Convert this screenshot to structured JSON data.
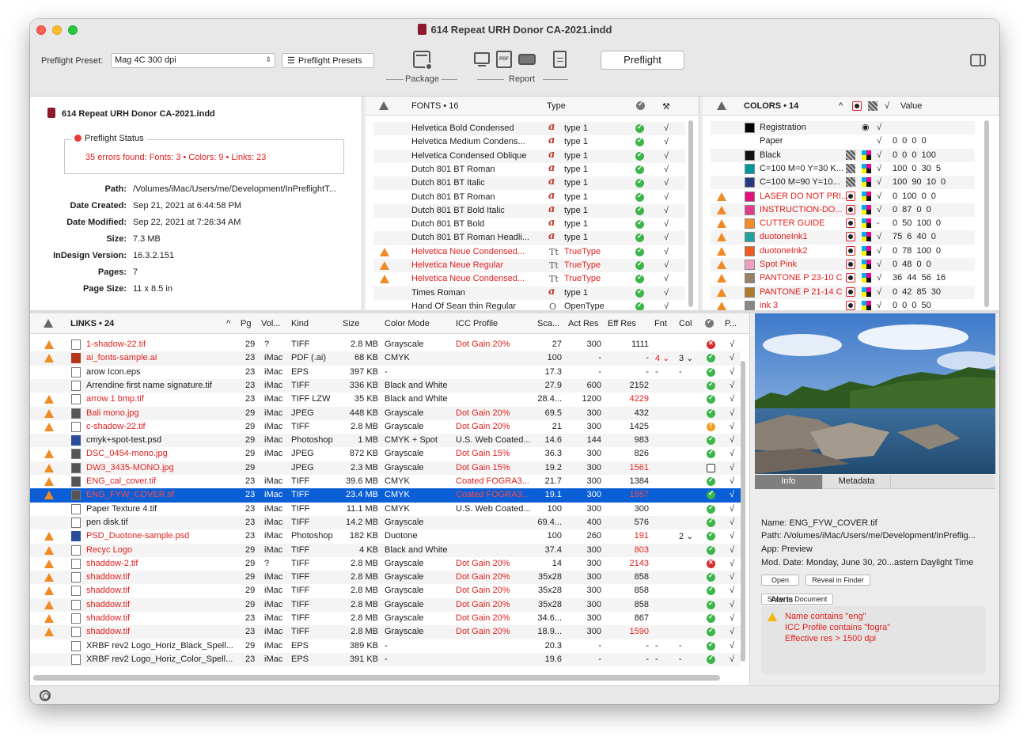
{
  "window": {
    "title": "614 Repeat URH Donor CA-2021.indd"
  },
  "toolbar": {
    "preset_label": "Preflight Preset:",
    "preset_value": "Mag 4C 300 dpi",
    "presets_button": "Preflight Presets",
    "package_label": "Package",
    "report_label": "Report",
    "preflight_button": "Preflight"
  },
  "info": {
    "doc_name": "614 Repeat URH Donor CA-2021.indd",
    "status_label": "Preflight Status",
    "status_errors": "35 errors found: Fonts: 3 • Colors: 9 • Links: 23",
    "rows": [
      {
        "k": "Path:",
        "v": "/Volumes/iMac/Users/me/Development/InPreflightT..."
      },
      {
        "k": "Date Created:",
        "v": "Sep 21, 2021 at 6:44:58 PM"
      },
      {
        "k": "Date Modified:",
        "v": "Sep 22, 2021 at 7:26:34 AM"
      },
      {
        "k": "Size:",
        "v": "7.3 MB"
      },
      {
        "k": "InDesign Version:",
        "v": "16.3.2.151"
      },
      {
        "k": "Pages:",
        "v": "7"
      },
      {
        "k": "Page Size:",
        "v": "11 x 8.5 in"
      }
    ]
  },
  "fonts": {
    "header": "FONTS • 16",
    "type_header": "Type",
    "rows": [
      {
        "name": "Helvetica Bold Condensed",
        "type": "type 1",
        "warn": false,
        "icon": "a"
      },
      {
        "name": "Helvetica Medium Condens...",
        "type": "type 1",
        "warn": false,
        "icon": "a"
      },
      {
        "name": "Helvetica Condensed Oblique",
        "type": "type 1",
        "warn": false,
        "icon": "a"
      },
      {
        "name": "Dutch 801 BT Roman",
        "type": "type 1",
        "warn": false,
        "icon": "a"
      },
      {
        "name": "Dutch 801 BT Italic",
        "type": "type 1",
        "warn": false,
        "icon": "a"
      },
      {
        "name": "Dutch 801 BT Roman",
        "type": "type 1",
        "warn": false,
        "icon": "a"
      },
      {
        "name": "Dutch 801 BT Bold Italic",
        "type": "type 1",
        "warn": false,
        "icon": "a"
      },
      {
        "name": "Dutch 801 BT Bold",
        "type": "type 1",
        "warn": false,
        "icon": "a"
      },
      {
        "name": "Dutch 801 BT Roman Headli...",
        "type": "type 1",
        "warn": false,
        "icon": "a"
      },
      {
        "name": "Helvetica Neue Condensed...",
        "type": "TrueType",
        "warn": true,
        "icon": "T"
      },
      {
        "name": "Helvetica Neue Regular",
        "type": "TrueType",
        "warn": true,
        "icon": "T"
      },
      {
        "name": "Helvetica Neue Condensed...",
        "type": "TrueType",
        "warn": true,
        "icon": "T"
      },
      {
        "name": "Times Roman",
        "type": "type 1",
        "warn": false,
        "icon": "a"
      },
      {
        "name": "Hand Of Sean thin Regular",
        "type": "OpenType",
        "warn": false,
        "icon": "O"
      }
    ]
  },
  "colors": {
    "header": "COLORS • 14",
    "value_header": "Value",
    "rows": [
      {
        "name": "Registration",
        "value": "",
        "color": "#000000",
        "warn": false,
        "kind": "reg"
      },
      {
        "name": "Paper",
        "value": "0 0 0 0",
        "color": "",
        "warn": false,
        "kind": "none"
      },
      {
        "name": "Black",
        "value": "0 0 0 100",
        "color": "#111111",
        "warn": false,
        "kind": "proc"
      },
      {
        "name": "C=100 M=0 Y=30 K...",
        "value": "100 0 30 5",
        "color": "#00979b",
        "warn": false,
        "kind": "proc"
      },
      {
        "name": "C=100 M=90 Y=10...",
        "value": "100 90 10 0",
        "color": "#263a84",
        "warn": false,
        "kind": "proc"
      },
      {
        "name": "LASER DO NOT PRI...",
        "value": "0 100 0 0",
        "color": "#e0117a",
        "warn": true,
        "kind": "spot"
      },
      {
        "name": "INSTRUCTION-DO...",
        "value": "0 87 0 0",
        "color": "#e33b8f",
        "warn": true,
        "kind": "spot"
      },
      {
        "name": "CUTTER GUIDE",
        "value": "0 50 100 0",
        "color": "#f28c28",
        "warn": true,
        "kind": "spot"
      },
      {
        "name": "duotoneInk1",
        "value": "75 6 40 0",
        "color": "#20a39e",
        "warn": true,
        "kind": "spot"
      },
      {
        "name": "duotoneInk2",
        "value": "0 78 100 0",
        "color": "#ef5a24",
        "warn": true,
        "kind": "spot"
      },
      {
        "name": "Spot Pink",
        "value": "0 48 0 0",
        "color": "#f19ec2",
        "warn": true,
        "kind": "spot"
      },
      {
        "name": "PANTONE P 23-10 C",
        "value": "36 44 56 16",
        "color": "#9b8069",
        "warn": true,
        "kind": "spot"
      },
      {
        "name": "PANTONE P 21-14 C",
        "value": "0 42 85 30",
        "color": "#b07a2d",
        "warn": true,
        "kind": "spot"
      },
      {
        "name": "ink 3",
        "value": "0 0 0 50",
        "color": "#888888",
        "warn": true,
        "kind": "spot"
      }
    ]
  },
  "links": {
    "header": "LINKS • 24",
    "columns": [
      "Pg",
      "Vol...",
      "Kind",
      "Size",
      "Color Mode",
      "ICC Profile",
      "Sca...",
      "Act Res",
      "Eff Res",
      "Fnt",
      "Col",
      "P..."
    ],
    "rows": [
      {
        "name": "1-shadow-22.tif",
        "pg": "29",
        "vol": "?",
        "kind": "TIFF",
        "size": "2.8 MB",
        "mode": "Grayscale",
        "icc": "Dot Gain 20%",
        "sca": "27",
        "act": "300",
        "eff": "1111",
        "fnt": "",
        "col": "",
        "warn": true,
        "status": "err",
        "effred": false,
        "thumb": "plain"
      },
      {
        "name": "ai_fonts-sample.ai",
        "pg": "23",
        "vol": "iMac",
        "kind": "PDF (.ai)",
        "size": "68 KB",
        "mode": "CMYK",
        "icc": "",
        "sca": "100",
        "act": "-",
        "eff": "-",
        "fnt": "4 ⌄",
        "col": "3 ⌄",
        "warn": true,
        "status": "ok",
        "effred": false,
        "thumb": "ai"
      },
      {
        "name": "arow Icon.eps",
        "pg": "23",
        "vol": "iMac",
        "kind": "EPS",
        "size": "397 KB",
        "mode": "-",
        "icc": "",
        "sca": "17.3",
        "act": "-",
        "eff": "-",
        "fnt": "-",
        "col": "-",
        "warn": false,
        "status": "ok",
        "effred": false,
        "thumb": "plain"
      },
      {
        "name": "Arrendine first name signature.tif",
        "pg": "23",
        "vol": "iMac",
        "kind": "TIFF",
        "size": "336 KB",
        "mode": "Black and White",
        "icc": "",
        "sca": "27.9",
        "act": "600",
        "eff": "2152",
        "fnt": "",
        "col": "",
        "warn": false,
        "status": "ok",
        "effred": false,
        "thumb": "plain"
      },
      {
        "name": "arrow 1 bmp.tif",
        "pg": "23",
        "vol": "iMac",
        "kind": "TIFF LZW",
        "size": "35 KB",
        "mode": "Black and White",
        "icc": "",
        "sca": "28.4...",
        "act": "1200",
        "eff": "4229",
        "fnt": "",
        "col": "",
        "warn": true,
        "status": "ok",
        "effred": true,
        "thumb": "plain"
      },
      {
        "name": "Bali mono.jpg",
        "pg": "29",
        "vol": "iMac",
        "kind": "JPEG",
        "size": "448 KB",
        "mode": "Grayscale",
        "icc": "Dot Gain 20%",
        "sca": "69.5",
        "act": "300",
        "eff": "432",
        "fnt": "",
        "col": "",
        "warn": true,
        "status": "ok",
        "effred": false,
        "thumb": "dark"
      },
      {
        "name": "c-shadow-22.tif",
        "pg": "29",
        "vol": "iMac",
        "kind": "TIFF",
        "size": "2.8 MB",
        "mode": "Grayscale",
        "icc": "Dot Gain 20%",
        "sca": "21",
        "act": "300",
        "eff": "1425",
        "fnt": "",
        "col": "",
        "warn": true,
        "status": "warn",
        "effred": false,
        "thumb": "plain"
      },
      {
        "name": "cmyk+spot-test.psd",
        "pg": "29",
        "vol": "iMac",
        "kind": "Photoshop",
        "size": "1 MB",
        "mode": "CMYK + Spot",
        "icc": "U.S. Web Coated...",
        "sca": "14.6",
        "act": "144",
        "eff": "983",
        "fnt": "",
        "col": "",
        "warn": false,
        "status": "ok",
        "effred": false,
        "thumb": "blue"
      },
      {
        "name": "DSC_0454-mono.jpg",
        "pg": "29",
        "vol": "iMac",
        "kind": "JPEG",
        "size": "872 KB",
        "mode": "Grayscale",
        "icc": "Dot Gain 15%",
        "sca": "36.3",
        "act": "300",
        "eff": "826",
        "fnt": "",
        "col": "",
        "warn": true,
        "status": "ok",
        "effred": false,
        "thumb": "dark"
      },
      {
        "name": "DW3_3435-MONO.jpg",
        "pg": "29",
        "vol": "",
        "kind": "JPEG",
        "size": "2.3 MB",
        "mode": "Grayscale",
        "icc": "Dot Gain 15%",
        "sca": "19.2",
        "act": "300",
        "eff": "1561",
        "fnt": "",
        "col": "",
        "warn": true,
        "status": "link",
        "effred": true,
        "thumb": "dark"
      },
      {
        "name": "ENG_cal_cover.tif",
        "pg": "23",
        "vol": "iMac",
        "kind": "TIFF",
        "size": "39.6 MB",
        "mode": "CMYK",
        "icc": "Coated FOGRA3...",
        "sca": "21.7",
        "act": "300",
        "eff": "1384",
        "fnt": "",
        "col": "",
        "warn": true,
        "status": "ok",
        "effred": false,
        "thumb": "dark"
      },
      {
        "name": "ENG_FYW_COVER.tif",
        "pg": "23",
        "vol": "iMac",
        "kind": "TIFF",
        "size": "23.4 MB",
        "mode": "CMYK",
        "icc": "Coated FOGRA3...",
        "sca": "19.1",
        "act": "300",
        "eff": "1557",
        "fnt": "",
        "col": "",
        "warn": true,
        "status": "ok",
        "effred": true,
        "thumb": "dark",
        "selected": true
      },
      {
        "name": "Paper Texture 4.tif",
        "pg": "23",
        "vol": "iMac",
        "kind": "TIFF",
        "size": "11.1 MB",
        "mode": "CMYK",
        "icc": "U.S. Web Coated...",
        "sca": "100",
        "act": "300",
        "eff": "300",
        "fnt": "",
        "col": "",
        "warn": false,
        "status": "ok",
        "effred": false,
        "thumb": "plain"
      },
      {
        "name": "pen disk.tif",
        "pg": "23",
        "vol": "iMac",
        "kind": "TIFF",
        "size": "14.2 MB",
        "mode": "Grayscale",
        "icc": "",
        "sca": "69.4...",
        "act": "400",
        "eff": "576",
        "fnt": "",
        "col": "",
        "warn": false,
        "status": "ok",
        "effred": false,
        "thumb": "plain"
      },
      {
        "name": "PSD_Duotone-sample.psd",
        "pg": "23",
        "vol": "iMac",
        "kind": "Photoshop",
        "size": "182 KB",
        "mode": "Duotone",
        "icc": "",
        "sca": "100",
        "act": "260",
        "eff": "191",
        "fnt": "",
        "col": "2 ⌄",
        "warn": true,
        "status": "ok",
        "effred": true,
        "thumb": "blue"
      },
      {
        "name": "Recyc Logo",
        "pg": "29",
        "vol": "iMac",
        "kind": "TIFF",
        "size": "4 KB",
        "mode": "Black and White",
        "icc": "",
        "sca": "37.4",
        "act": "300",
        "eff": "803",
        "fnt": "",
        "col": "",
        "warn": true,
        "status": "ok",
        "effred": true,
        "thumb": "plain"
      },
      {
        "name": "shaddow-2.tif",
        "pg": "29",
        "vol": "?",
        "kind": "TIFF",
        "size": "2.8 MB",
        "mode": "Grayscale",
        "icc": "Dot Gain 20%",
        "sca": "14",
        "act": "300",
        "eff": "2143",
        "fnt": "",
        "col": "",
        "warn": true,
        "status": "err",
        "effred": true,
        "thumb": "plain"
      },
      {
        "name": "shaddow.tif",
        "pg": "29",
        "vol": "iMac",
        "kind": "TIFF",
        "size": "2.8 MB",
        "mode": "Grayscale",
        "icc": "Dot Gain 20%",
        "sca": "35x28",
        "act": "300",
        "eff": "858",
        "fnt": "",
        "col": "",
        "warn": true,
        "status": "ok",
        "effred": false,
        "thumb": "plain"
      },
      {
        "name": "shaddow.tif",
        "pg": "29",
        "vol": "iMac",
        "kind": "TIFF",
        "size": "2.8 MB",
        "mode": "Grayscale",
        "icc": "Dot Gain 20%",
        "sca": "35x28",
        "act": "300",
        "eff": "858",
        "fnt": "",
        "col": "",
        "warn": true,
        "status": "ok",
        "effred": false,
        "thumb": "plain"
      },
      {
        "name": "shaddow.tif",
        "pg": "29",
        "vol": "iMac",
        "kind": "TIFF",
        "size": "2.8 MB",
        "mode": "Grayscale",
        "icc": "Dot Gain 20%",
        "sca": "35x28",
        "act": "300",
        "eff": "858",
        "fnt": "",
        "col": "",
        "warn": true,
        "status": "ok",
        "effred": false,
        "thumb": "plain"
      },
      {
        "name": "shaddow.tif",
        "pg": "23",
        "vol": "iMac",
        "kind": "TIFF",
        "size": "2.8 MB",
        "mode": "Grayscale",
        "icc": "Dot Gain 20%",
        "sca": "34.6...",
        "act": "300",
        "eff": "867",
        "fnt": "",
        "col": "",
        "warn": true,
        "status": "ok",
        "effred": false,
        "thumb": "plain"
      },
      {
        "name": "shaddow.tif",
        "pg": "23",
        "vol": "iMac",
        "kind": "TIFF",
        "size": "2.8 MB",
        "mode": "Grayscale",
        "icc": "Dot Gain 20%",
        "sca": "18.9...",
        "act": "300",
        "eff": "1590",
        "fnt": "",
        "col": "",
        "warn": true,
        "status": "ok",
        "effred": true,
        "thumb": "plain"
      },
      {
        "name": "XRBF rev2 Logo_Horiz_Black_Spell...",
        "pg": "29",
        "vol": "iMac",
        "kind": "EPS",
        "size": "389 KB",
        "mode": "-",
        "icc": "",
        "sca": "20.3",
        "act": "-",
        "eff": "-",
        "fnt": "-",
        "col": "-",
        "warn": false,
        "status": "ok",
        "effred": false,
        "thumb": "plain"
      },
      {
        "name": "XRBF rev2 Logo_Horiz_Color_Spell...",
        "pg": "23",
        "vol": "iMac",
        "kind": "EPS",
        "size": "391 KB",
        "mode": "-",
        "icc": "",
        "sca": "19.6",
        "act": "-",
        "eff": "-",
        "fnt": "-",
        "col": "-",
        "warn": false,
        "status": "ok",
        "effred": false,
        "thumb": "plain"
      }
    ]
  },
  "preview": {
    "tab_info": "Info",
    "tab_metadata": "Metadata",
    "name": "Name:  ENG_FYW_COVER.tif",
    "path": "Path:  /Volumes/iMac/Users/me/Development/InPreflig...",
    "app": "App:  Preview",
    "mod": "Mod. Date:  Monday, June 30, 20...astern Daylight Time",
    "open_btn": "Open",
    "reveal_btn": "Reveal in Finder",
    "show_btn": "Show in Document",
    "alerts_title": "Alerts",
    "alerts": [
      "Name contains \"eng\"",
      "ICC Profile contains \"fogra\"",
      "Effective res > 1500 dpi"
    ]
  }
}
